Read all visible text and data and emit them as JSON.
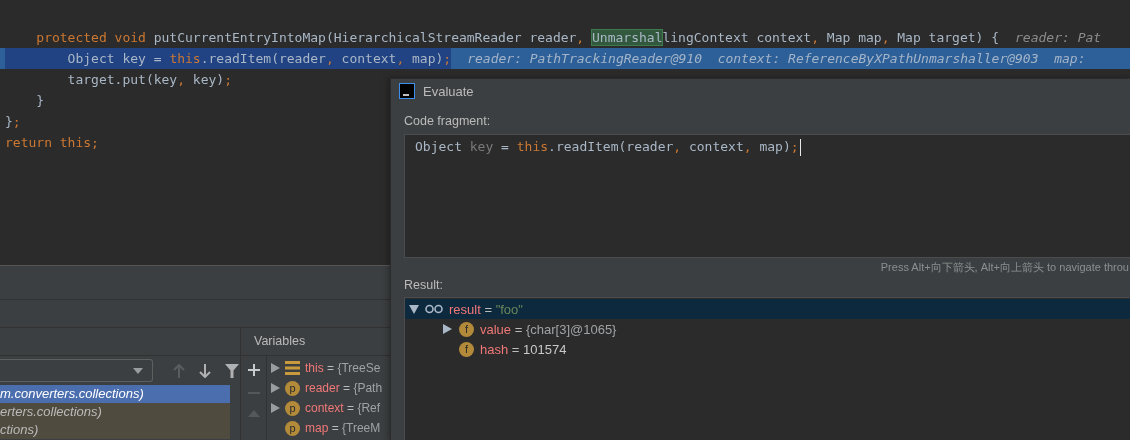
{
  "editor": {
    "lines": [
      {
        "current": false,
        "tokens": [
          {
            "kind": "keyword",
            "text": "    protected void "
          },
          {
            "kind": "plain",
            "text": "putCurrentEntryIntoMap(HierarchicalStreamReader reader"
          },
          {
            "kind": "keyword",
            "text": ", "
          },
          {
            "kind": "match",
            "text": "Unmarshal"
          },
          {
            "kind": "plain",
            "text": "lingContext context"
          },
          {
            "kind": "keyword",
            "text": ", "
          },
          {
            "kind": "plain",
            "text": "Map map"
          },
          {
            "kind": "keyword",
            "text": ", "
          },
          {
            "kind": "plain",
            "text": "Map target) {"
          }
        ],
        "hint": "reader: Pat"
      },
      {
        "current": true,
        "tokens": [
          {
            "kind": "plain",
            "text": "        Object key = "
          },
          {
            "kind": "keyword",
            "text": "this"
          },
          {
            "kind": "plain",
            "text": ".readItem(reader"
          },
          {
            "kind": "keyword",
            "text": ", "
          },
          {
            "kind": "plain",
            "text": "context"
          },
          {
            "kind": "keyword",
            "text": ", "
          },
          {
            "kind": "plain",
            "text": "map)"
          },
          {
            "kind": "keyword",
            "text": ";"
          }
        ],
        "hint": "reader: PathTrackingReader@910  context: ReferenceByXPathUnmarshaller@903  map:"
      },
      {
        "current": false,
        "tokens": [
          {
            "kind": "plain",
            "text": "        target.put(key"
          },
          {
            "kind": "keyword",
            "text": ", "
          },
          {
            "kind": "plain",
            "text": "key)"
          },
          {
            "kind": "keyword",
            "text": ";"
          }
        ]
      },
      {
        "current": false,
        "tokens": [
          {
            "kind": "plain",
            "text": "    }"
          }
        ]
      },
      {
        "current": false,
        "tokens": [
          {
            "kind": "plain",
            "text": "}"
          },
          {
            "kind": "keyword",
            "text": ";"
          }
        ]
      },
      {
        "current": false,
        "tokens": [
          {
            "kind": "keyword",
            "text": "return this;"
          }
        ]
      }
    ]
  },
  "frames": {
    "rows": [
      {
        "text": "m.converters.collections)",
        "selected": true,
        "library": false
      },
      {
        "text": "erters.collections)",
        "selected": false,
        "library": true
      },
      {
        "text": "ctions)",
        "selected": false,
        "library": true
      }
    ]
  },
  "variables": {
    "title": "Variables",
    "items": [
      {
        "kind": "object",
        "name": "this",
        "equals": "=",
        "value": "{TreeSe",
        "expandable": true
      },
      {
        "kind": "parameter",
        "badge": "p",
        "name": "reader",
        "equals": "=",
        "value": "{Path",
        "expandable": true
      },
      {
        "kind": "parameter",
        "badge": "p",
        "name": "context",
        "equals": "=",
        "value": "{Ref",
        "expandable": true
      },
      {
        "kind": "parameter",
        "badge": "p",
        "name": "map",
        "equals": "=",
        "value": "{TreeM",
        "expandable": false
      }
    ]
  },
  "evaluate": {
    "title": "Evaluate",
    "code_label": "Code fragment:",
    "code": [
      {
        "kind": "plain",
        "text": "Object "
      },
      {
        "kind": "unused",
        "text": "key"
      },
      {
        "kind": "plain",
        "text": " = "
      },
      {
        "kind": "keyword",
        "text": "this"
      },
      {
        "kind": "plain",
        "text": ".readItem(reader"
      },
      {
        "kind": "keyword",
        "text": ", "
      },
      {
        "kind": "plain",
        "text": "context"
      },
      {
        "kind": "keyword",
        "text": ", "
      },
      {
        "kind": "plain",
        "text": "map)"
      },
      {
        "kind": "keyword",
        "text": ";"
      }
    ],
    "navigation_hint": "Press Alt+向下箭头, Alt+向上箭头 to navigate throu",
    "result_label": "Result:",
    "result": [
      {
        "kind": "string",
        "name": "result",
        "equals": "=",
        "value": "\"foo\"",
        "selected": true,
        "expanded": true,
        "children": [
          {
            "kind": "object",
            "badge": "f",
            "name": "value",
            "equals": "=",
            "value": "{char[3]@1065}",
            "selected": false,
            "expanded": false,
            "expandable": true
          },
          {
            "kind": "number",
            "badge": "f",
            "name": "hash",
            "equals": "=",
            "value": "101574",
            "selected": false,
            "expandable": false
          }
        ]
      }
    ]
  }
}
